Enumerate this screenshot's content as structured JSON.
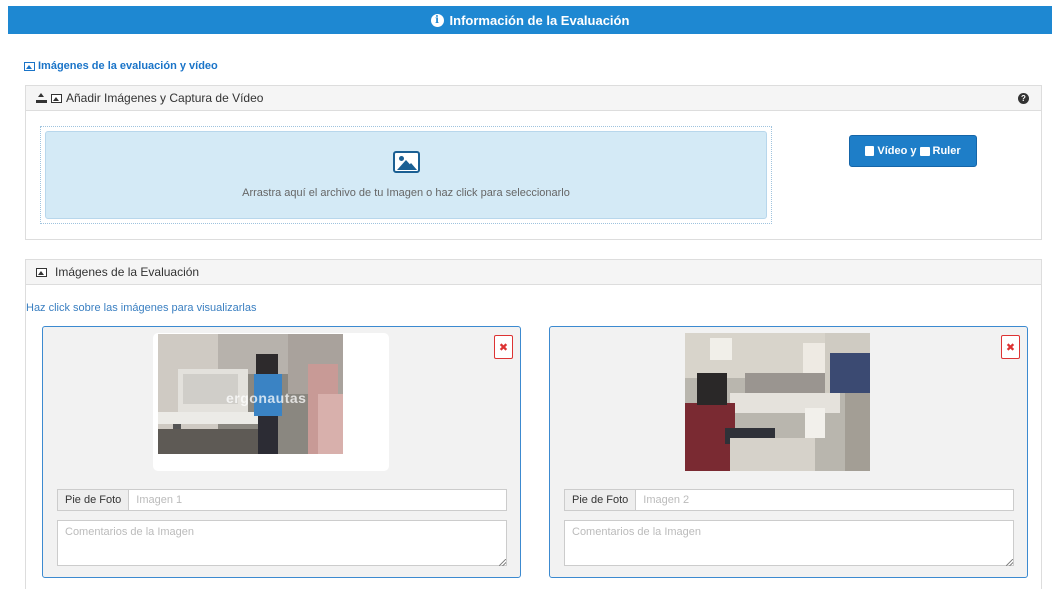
{
  "header": {
    "title": "Información de la Evaluación",
    "icon": "info-icon"
  },
  "section_link": {
    "label": "Imágenes de la evaluación y vídeo",
    "icon": "image-icon"
  },
  "upload_panel": {
    "title": "Añadir Imágenes y Captura de Vídeo",
    "icons": [
      "upload-icon",
      "image-icon"
    ],
    "help_icon": "question-circle-icon",
    "dropzone_text": "Arrastra aquí el archivo de tu Imagen o haz click para seleccionarlo",
    "dropzone_icon": "picture-icon",
    "video_button": {
      "part1": "Vídeo y",
      "part2": "Ruler",
      "icons": [
        "file-icon",
        "ruler-icon"
      ]
    }
  },
  "images_panel": {
    "title": "Imágenes de la Evaluación",
    "icon": "image-icon",
    "hint": "Haz click sobre las imágenes para visualizarlas",
    "cards": [
      {
        "caption_label": "Pie de Foto",
        "caption_placeholder": "Imagen 1",
        "comments_placeholder": "Comentarios de la Imagen",
        "watermark": "ergonautas",
        "delete_icon": "close-icon"
      },
      {
        "caption_label": "Pie de Foto",
        "caption_placeholder": "Imagen 2",
        "comments_placeholder": "Comentarios de la Imagen",
        "delete_icon": "close-icon"
      }
    ]
  },
  "colors": {
    "primary": "#1e88d2",
    "link": "#1a74c8",
    "dropzone_bg": "#d4eaf6",
    "card_border": "#3c8ad0",
    "danger": "#dd3333"
  }
}
